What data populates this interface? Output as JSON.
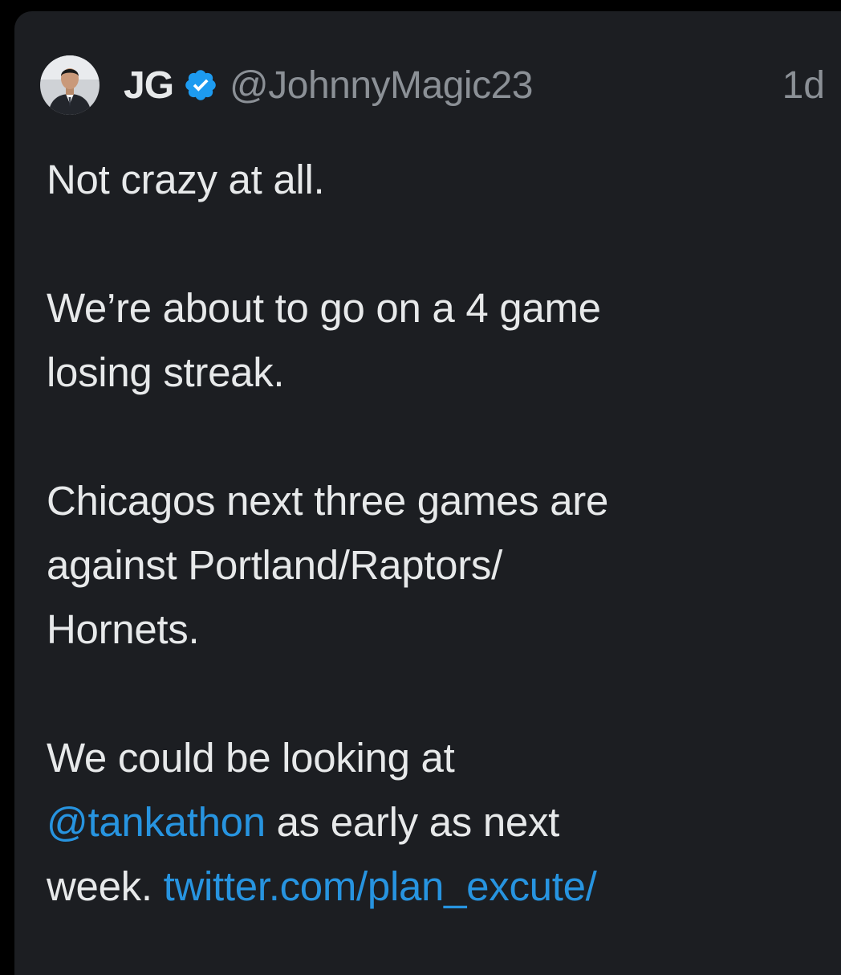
{
  "tweet": {
    "display_name": "JG",
    "handle": "@JohnnyMagic23",
    "time": "1d",
    "avatar_icon": "profile-photo",
    "verified_icon": "verified-badge-icon",
    "colors": {
      "background": "#1c1e22",
      "text": "#e7e9ea",
      "muted": "#8b9096",
      "link": "#2794e0",
      "verified": "#1d9bf0"
    },
    "body": {
      "p1": "Not crazy at all.",
      "p2_line1": "We’re about to go on a 4 game",
      "p2_line2": "losing streak.",
      "p3_line1": "Chicagos next three games are",
      "p3_line2": "against Portland/Raptors/",
      "p3_line3": "Hornets.",
      "p4_line1": "We could be looking at",
      "p4_mention": "@tankathon",
      "p4_line2_rest": " as early as next",
      "p4_line3_start": "week. ",
      "p4_url": "twitter.com/plan_excute/"
    }
  }
}
